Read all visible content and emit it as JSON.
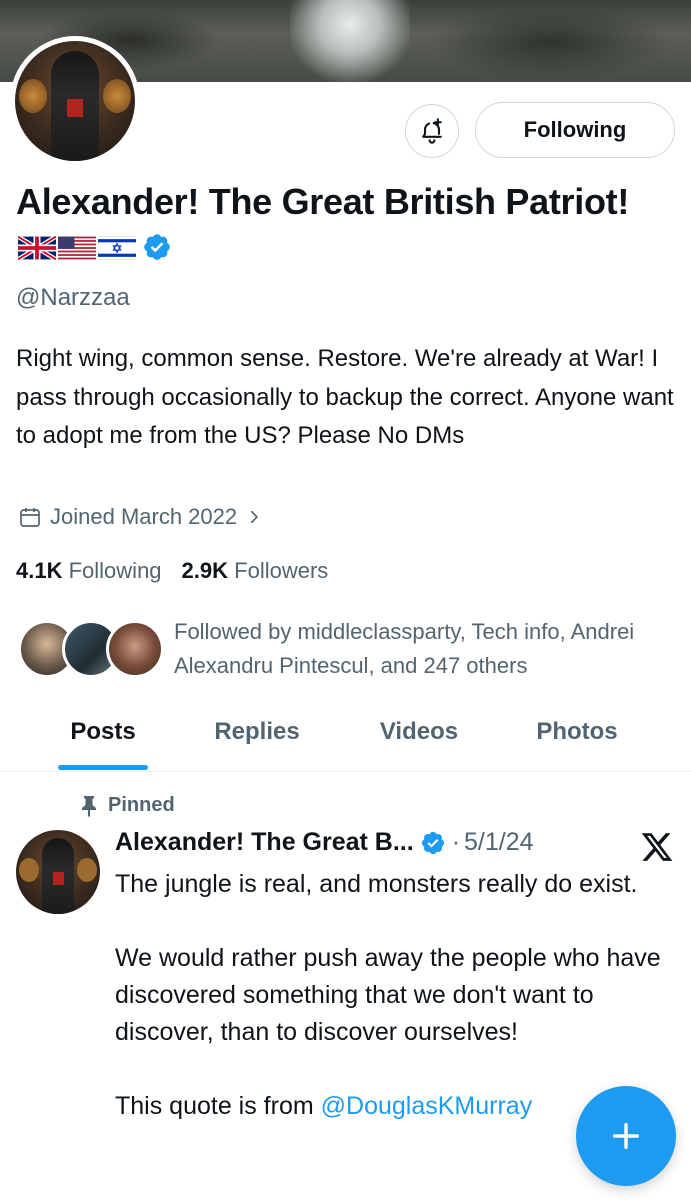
{
  "profile": {
    "display_name": "Alexander! The Great British Patriot!",
    "handle": "@Narzzaa",
    "bio": "Right wing, common sense. Restore. We're already at War! I pass through occasionally to backup the correct. Anyone want to adopt me from the US? Please No DMs",
    "joined": "Joined March 2022",
    "following_count": "4.1K",
    "following_label": "Following",
    "followers_count": "2.9K",
    "followers_label": "Followers",
    "follow_button_label": "Following",
    "followed_by": "Followed by middleclassparty, Tech info, Andrei Alexandru Pintescul, and 247 others"
  },
  "tabs": [
    {
      "label": "Posts",
      "active": true
    },
    {
      "label": "Replies",
      "active": false
    },
    {
      "label": "Videos",
      "active": false
    },
    {
      "label": "Photos",
      "active": false
    }
  ],
  "post": {
    "pinned_label": "Pinned",
    "author": "Alexander! The Great B...",
    "separator": "·",
    "date": "5/1/24",
    "paragraph_1": "The jungle is real, and monsters really do exist.",
    "paragraph_2": "We would rather push away the people who have discovered something that we don't want to discover, than to discover ourselves!",
    "paragraph_3_prefix": "This quote is from ",
    "mention": "@DouglasKMurray"
  },
  "colors": {
    "accent": "#1d9bf0",
    "text_primary": "#0f1419",
    "text_secondary": "#536471",
    "border": "#cfd9de"
  },
  "icons": {
    "notify": "bell-plus-icon",
    "verified": "verified-badge-icon",
    "calendar": "calendar-icon",
    "chevron": "chevron-right-icon",
    "pin": "pin-icon",
    "platform": "x-logo-icon",
    "compose": "plus-icon"
  }
}
